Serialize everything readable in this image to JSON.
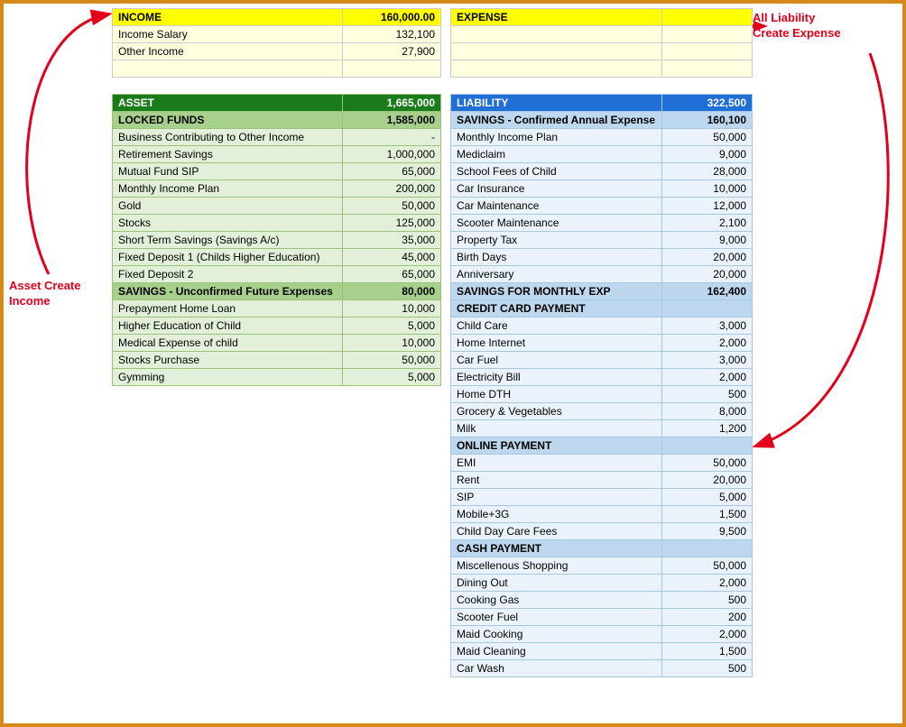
{
  "notes": {
    "left_line1": "Asset Create",
    "left_line2": "Income",
    "right_line1": "All Liability",
    "right_line2": "Create Expense"
  },
  "income": {
    "header_label": "INCOME",
    "header_value": "160,000.00",
    "rows": [
      {
        "label": "Income Salary",
        "value": "132,100"
      },
      {
        "label": "Other Income",
        "value": "27,900"
      }
    ]
  },
  "expense": {
    "header_label": "EXPENSE",
    "header_value": ""
  },
  "asset": {
    "header_label": "ASSET",
    "header_value": "1,665,000",
    "sections": [
      {
        "title": "LOCKED FUNDS",
        "total": "1,585,000",
        "rows": [
          {
            "label": "Business Contributing to Other Income",
            "value": "-"
          },
          {
            "label": "Retirement Savings",
            "value": "1,000,000"
          },
          {
            "label": "Mutual Fund SIP",
            "value": "65,000"
          },
          {
            "label": "Monthly Income Plan",
            "value": "200,000"
          },
          {
            "label": "Gold",
            "value": "50,000"
          },
          {
            "label": "Stocks",
            "value": "125,000"
          },
          {
            "label": "Short Term Savings (Savings A/c)",
            "value": "35,000"
          },
          {
            "label": "Fixed Deposit 1 (Childs Higher Education)",
            "value": "45,000"
          },
          {
            "label": "Fixed Deposit 2",
            "value": "65,000"
          }
        ]
      },
      {
        "title": "SAVINGS - Unconfirmed Future Expenses",
        "total": "80,000",
        "rows": [
          {
            "label": "Prepayment Home Loan",
            "value": "10,000"
          },
          {
            "label": "Higher Education of Child",
            "value": "5,000"
          },
          {
            "label": "Medical Expense of child",
            "value": "10,000"
          },
          {
            "label": "Stocks Purchase",
            "value": "50,000"
          },
          {
            "label": "Gymming",
            "value": "5,000"
          }
        ]
      }
    ]
  },
  "liability": {
    "header_label": "LIABILITY",
    "header_value": "322,500",
    "sections": [
      {
        "title": "SAVINGS - Confirmed Annual Expense",
        "total": "160,100",
        "rows": [
          {
            "label": "Monthly Income Plan",
            "value": "50,000"
          },
          {
            "label": "Mediclaim",
            "value": "9,000"
          },
          {
            "label": "School Fees of Child",
            "value": "28,000"
          },
          {
            "label": "Car Insurance",
            "value": "10,000"
          },
          {
            "label": "Car Maintenance",
            "value": "12,000"
          },
          {
            "label": "Scooter Maintenance",
            "value": "2,100"
          },
          {
            "label": "Property Tax",
            "value": "9,000"
          },
          {
            "label": "Birth Days",
            "value": "20,000"
          },
          {
            "label": "Anniversary",
            "value": "20,000"
          }
        ]
      },
      {
        "title": "SAVINGS FOR MONTHLY EXP",
        "total": "162,400",
        "rows": []
      },
      {
        "title": "CREDIT CARD PAYMENT",
        "total": "",
        "rows": [
          {
            "label": "Child Care",
            "value": "3,000"
          },
          {
            "label": "Home Internet",
            "value": "2,000"
          },
          {
            "label": "Car Fuel",
            "value": "3,000"
          },
          {
            "label": "Electricity Bill",
            "value": "2,000"
          },
          {
            "label": "Home DTH",
            "value": "500"
          },
          {
            "label": "Grocery & Vegetables",
            "value": "8,000"
          },
          {
            "label": "Milk",
            "value": "1,200"
          }
        ]
      },
      {
        "title": "ONLINE PAYMENT",
        "total": "",
        "rows": [
          {
            "label": "EMI",
            "value": "50,000"
          },
          {
            "label": "Rent",
            "value": "20,000"
          },
          {
            "label": "SIP",
            "value": "5,000"
          },
          {
            "label": "Mobile+3G",
            "value": "1,500"
          },
          {
            "label": "Child Day Care Fees",
            "value": "9,500"
          }
        ]
      },
      {
        "title": "CASH PAYMENT",
        "total": "",
        "rows": [
          {
            "label": "Miscellenous Shopping",
            "value": "50,000"
          },
          {
            "label": "Dining Out",
            "value": "2,000"
          },
          {
            "label": "Cooking Gas",
            "value": "500"
          },
          {
            "label": "Scooter Fuel",
            "value": "200"
          },
          {
            "label": "Maid Cooking",
            "value": "2,000"
          },
          {
            "label": "Maid Cleaning",
            "value": "1,500"
          },
          {
            "label": "Car Wash",
            "value": "500"
          }
        ]
      }
    ]
  }
}
